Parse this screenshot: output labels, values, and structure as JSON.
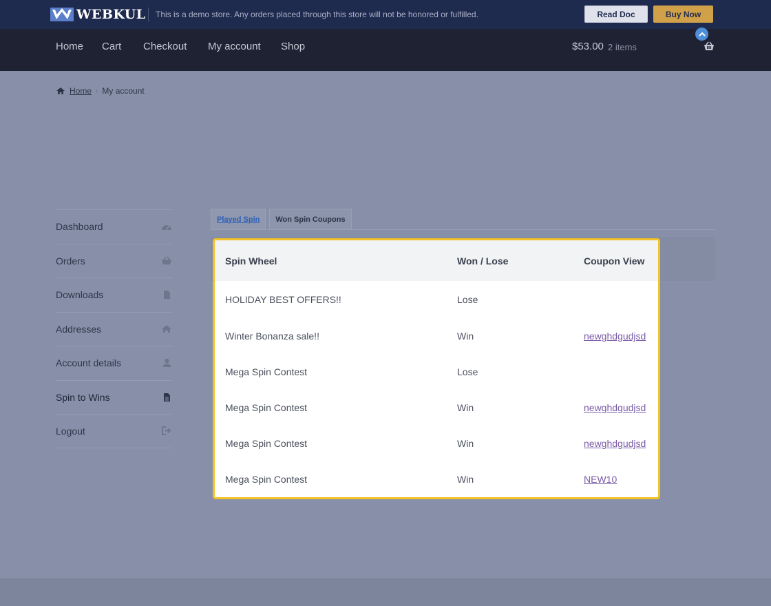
{
  "topbar": {
    "logo_text": "WEBKUL",
    "demo_notice": "This is a demo store. Any orders placed through this store will not be honored or fulfilled.",
    "read_doc_label": "Read Doc",
    "buy_now_label": "Buy Now"
  },
  "nav": {
    "items": [
      "Home",
      "Cart",
      "Checkout",
      "My account",
      "Shop"
    ],
    "cart_total": "$53.00",
    "cart_count": "2 items"
  },
  "breadcrumb": {
    "home": "Home",
    "current": "My account"
  },
  "sidebar": {
    "items": [
      {
        "label": "Dashboard",
        "icon": "dashboard-icon"
      },
      {
        "label": "Orders",
        "icon": "basket-icon"
      },
      {
        "label": "Downloads",
        "icon": "file-icon"
      },
      {
        "label": "Addresses",
        "icon": "home-icon"
      },
      {
        "label": "Account details",
        "icon": "user-icon"
      },
      {
        "label": "Spin to Wins",
        "icon": "file-text-icon"
      },
      {
        "label": "Logout",
        "icon": "logout-icon"
      }
    ]
  },
  "tabs": [
    {
      "label": "Played Spin",
      "active": true
    },
    {
      "label": "Won Spin Coupons",
      "active": false
    }
  ],
  "table": {
    "headers": [
      "Spin Wheel",
      "Won / Lose",
      "Coupon View"
    ],
    "rows": [
      {
        "wheel": "HOLIDAY BEST OFFERS!!",
        "result": "Lose",
        "coupon": ""
      },
      {
        "wheel": "Winter Bonanza sale!!",
        "result": "Win",
        "coupon": "newghdgudjsd"
      },
      {
        "wheel": "Mega Spin Contest",
        "result": "Lose",
        "coupon": ""
      },
      {
        "wheel": "Mega Spin Contest",
        "result": "Win",
        "coupon": "newghdgudjsd"
      },
      {
        "wheel": "Mega Spin Contest",
        "result": "Win",
        "coupon": "newghdgudjsd"
      },
      {
        "wheel": "Mega Spin Contest",
        "result": "Win",
        "coupon": "NEW10"
      }
    ]
  },
  "colors": {
    "topbar_bg": "#1f2a4f",
    "navbar_bg": "#1e2233",
    "modal_border": "#f3c224",
    "buy_button": "#d1a14a",
    "link": "#7a5ca8"
  }
}
